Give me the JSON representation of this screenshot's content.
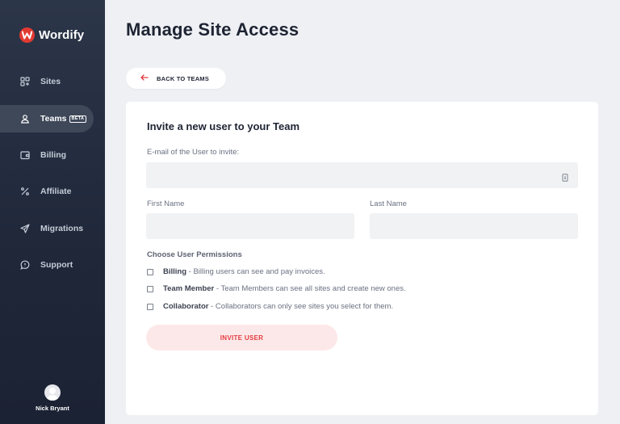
{
  "brand": {
    "name": "Wordify",
    "mark_letter": "W",
    "color": "#e23a32"
  },
  "sidebar": {
    "items": [
      {
        "label": "Sites",
        "icon": "grid-plus-icon",
        "active": false
      },
      {
        "label": "Teams",
        "icon": "user-icon",
        "active": true,
        "badge": "BETA"
      },
      {
        "label": "Billing",
        "icon": "wallet-icon",
        "active": false
      },
      {
        "label": "Affiliate",
        "icon": "percent-icon",
        "active": false
      },
      {
        "label": "Migrations",
        "icon": "paper-plane-icon",
        "active": false
      },
      {
        "label": "Support",
        "icon": "chat-bubble-icon",
        "active": false
      }
    ],
    "user": {
      "name": "Nick Bryant"
    }
  },
  "header": {
    "title": "Manage Site Access"
  },
  "back_button": {
    "label": "BACK TO TEAMS",
    "icon": "arrow-left-icon"
  },
  "form": {
    "title": "Invite a new user to your Team",
    "email_label": "E-mail of the User to invite:",
    "email_value": "",
    "email_placeholder": "",
    "first_name_label": "First Name",
    "first_name_value": "",
    "last_name_label": "Last Name",
    "last_name_value": "",
    "permissions_label": "Choose User Permissions",
    "permissions": [
      {
        "name": "Billing",
        "description": " - Billing users can see and pay invoices.",
        "checked": false
      },
      {
        "name": "Team Member",
        "description": " - Team Members can see all sites and create new ones.",
        "checked": false
      },
      {
        "name": "Collaborator",
        "description": " - Collaborators can only see sites you select for them.",
        "checked": false
      }
    ],
    "submit_label": "INVITE USER"
  },
  "colors": {
    "accent": "#e33c3f",
    "accent_soft": "#fde8e9",
    "sidebar_bg": "#1f2739",
    "page_bg": "#eef0f4"
  }
}
